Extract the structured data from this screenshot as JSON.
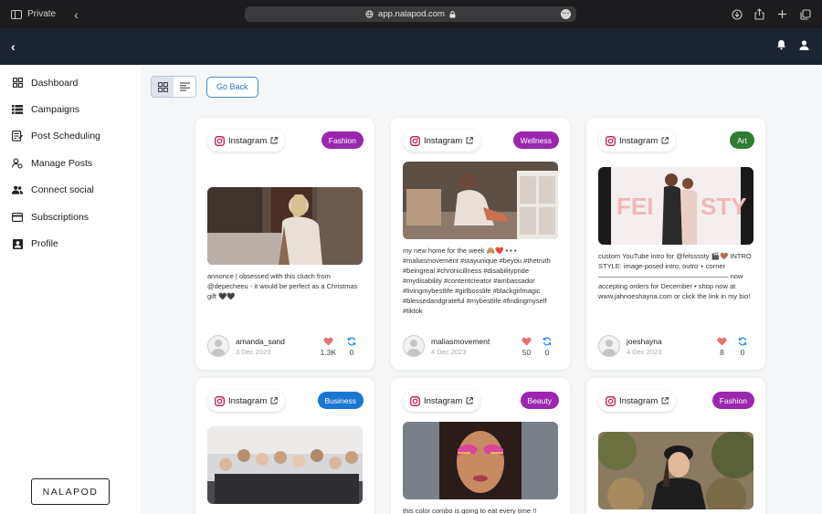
{
  "browser": {
    "private_label": "Private",
    "url": "app.nalapod.com"
  },
  "sidebar": {
    "items": [
      {
        "label": "Dashboard",
        "icon": "grid-icon"
      },
      {
        "label": "Campaigns",
        "icon": "campaigns-icon"
      },
      {
        "label": "Post Scheduling",
        "icon": "schedule-icon"
      },
      {
        "label": "Manage Posts",
        "icon": "manage-posts-icon"
      },
      {
        "label": "Connect social",
        "icon": "people-icon"
      },
      {
        "label": "Subscriptions",
        "icon": "credit-card-icon"
      },
      {
        "label": "Profile",
        "icon": "profile-icon"
      }
    ],
    "logo": "NALAPOD"
  },
  "toolbar": {
    "go_back_label": "Go Back"
  },
  "colors": {
    "fashion": "#9b27af",
    "wellness": "#9b27af",
    "art": "#2e7d32",
    "business": "#1976d2",
    "beauty": "#9b27af",
    "like": "#e57373",
    "refresh": "#1e88e5"
  },
  "posts": [
    {
      "platform": "Instagram",
      "category": "Fashion",
      "caption": "annonce | obsessed with this clutch from @depecheeu - it would be perfect as a Christmas gift 🖤🖤",
      "username": "amanda_sand",
      "date": "3 Dec 2023",
      "likes": "1.3K",
      "shares": "0"
    },
    {
      "platform": "Instagram",
      "category": "Wellness",
      "caption": "my new home for the week 🙈❤️ • • • #maliasmovement #stayunique #beyou #thetruth #beingreal #chronicillness #disabilitypride #mydisability #contentcreator #ambassador #livingmybestlife #girlbosslife #blackgirlmagic #blessedandgrateful #mybestlife #findingmyself #tiktok",
      "username": "maliasmovement",
      "date": "4 Dec 2023",
      "likes": "50",
      "shares": "0"
    },
    {
      "platform": "Instagram",
      "category": "Art",
      "caption": "custom YouTube intro for @felssssty 🎬🤎 INTRO STYLE: image-posed intro, outro + corner ——————————————————— now accepting orders for December • shop now at www.jahnoeshayna.com or click the link in my bio!",
      "username": "joeshayna",
      "date": "4 Dec 2023",
      "likes": "8",
      "shares": "0"
    },
    {
      "platform": "Instagram",
      "category": "Business",
      "caption": "",
      "username": "",
      "date": "",
      "likes": "",
      "shares": ""
    },
    {
      "platform": "Instagram",
      "category": "Beauty",
      "caption": "this color combo is going to eat every time !!",
      "username": "",
      "date": "",
      "likes": "",
      "shares": ""
    },
    {
      "platform": "Instagram",
      "category": "Fashion",
      "caption": "",
      "username": "",
      "date": "",
      "likes": "",
      "shares": ""
    }
  ]
}
